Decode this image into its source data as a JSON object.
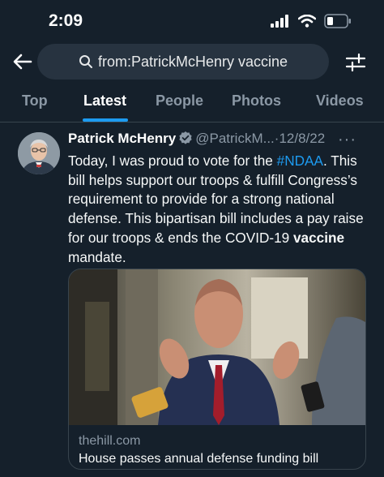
{
  "status_bar": {
    "time": "2:09"
  },
  "search": {
    "query": "from:PatrickMcHenry vaccine"
  },
  "tabs": [
    {
      "label": "Top",
      "active": false
    },
    {
      "label": "Latest",
      "active": true
    },
    {
      "label": "People",
      "active": false
    },
    {
      "label": "Photos",
      "active": false
    },
    {
      "label": "Videos",
      "active": false
    }
  ],
  "tweet": {
    "author": "Patrick McHenry",
    "handle": "@PatrickM...",
    "separator": "·",
    "date": "12/8/22",
    "more": "···",
    "text": {
      "part1": "Today, I was proud to vote for the ",
      "hashtag": "#NDAA",
      "part2": ". This bill helps support our troops & fulfill Congress’s requirement to provide for a strong national defense. This bipartisan bill includes a pay raise for our troops & ends the COVID-19 ",
      "bold": "vaccine",
      "part3": " mandate."
    }
  },
  "card": {
    "domain": "thehill.com",
    "title": "House passes annual defense funding bill"
  },
  "colors": {
    "background": "#15202b",
    "accent": "#1d9bf0",
    "muted": "#8b98a5"
  }
}
